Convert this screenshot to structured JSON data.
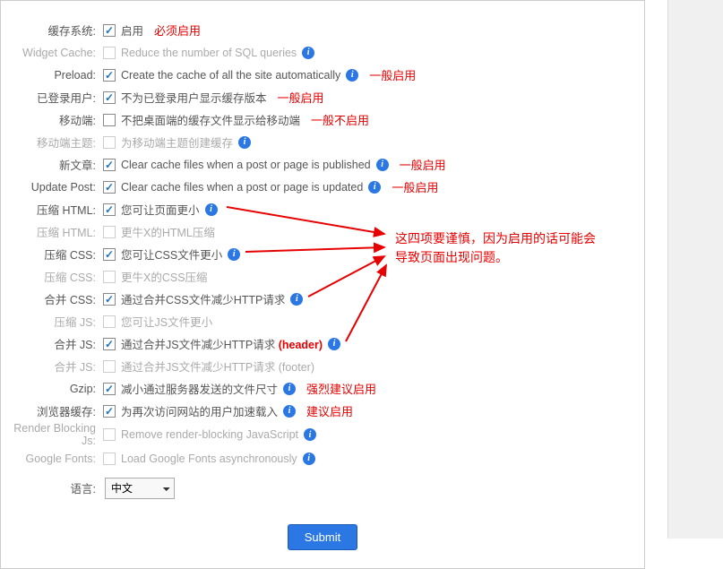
{
  "rows": {
    "cache": {
      "label": "缓存系统:",
      "desc": "启用",
      "checked": true,
      "disabled": false,
      "info": false,
      "note": "必须启用"
    },
    "widget": {
      "label": "Widget Cache:",
      "desc": "Reduce the number of SQL queries",
      "checked": false,
      "disabled": true,
      "info": true
    },
    "preload": {
      "label": "Preload:",
      "desc": "Create the cache of all the site automatically",
      "checked": true,
      "disabled": false,
      "info": true,
      "note": "一般启用"
    },
    "loggedin": {
      "label": "已登录用户:",
      "desc": "不为已登录用户显示缓存版本",
      "checked": true,
      "disabled": false,
      "info": false,
      "note": "一般启用"
    },
    "mobile": {
      "label": "移动端:",
      "desc": "不把桌面端的缓存文件显示给移动端",
      "checked": false,
      "disabled": false,
      "info": false,
      "note": "一般不启用"
    },
    "mobiletheme": {
      "label": "移动端主题:",
      "desc": "为移动端主题创建缓存",
      "checked": false,
      "disabled": true,
      "info": true
    },
    "newpost": {
      "label": "新文章:",
      "desc": "Clear cache files when a post or page is published",
      "checked": true,
      "disabled": false,
      "info": true,
      "note": "一般启用"
    },
    "updatepost": {
      "label": "Update Post:",
      "desc": "Clear cache files when a post or page is updated",
      "checked": true,
      "disabled": false,
      "info": true,
      "note": "一般启用"
    },
    "minhtml": {
      "label": "压缩 HTML:",
      "desc": "您可让页面更小",
      "checked": true,
      "disabled": false,
      "info": true
    },
    "minhtml2": {
      "label": "压缩 HTML:",
      "desc": "更牛X的HTML压缩",
      "checked": false,
      "disabled": true,
      "info": false
    },
    "mincss": {
      "label": "压缩 CSS:",
      "desc": "您可让CSS文件更小",
      "checked": true,
      "disabled": false,
      "info": true
    },
    "mincss2": {
      "label": "压缩 CSS:",
      "desc": "更牛X的CSS压缩",
      "checked": false,
      "disabled": true,
      "info": false
    },
    "combinecss": {
      "label": "合并 CSS:",
      "desc": "通过合并CSS文件减少HTTP请求",
      "checked": true,
      "disabled": false,
      "info": true
    },
    "minjs": {
      "label": "压缩 JS:",
      "desc": "您可让JS文件更小",
      "checked": false,
      "disabled": true,
      "info": false
    },
    "combinejsh": {
      "label": "合并 JS:",
      "desc": "通过合并JS文件减少HTTP请求",
      "header": "(header)",
      "checked": true,
      "disabled": false,
      "info": true
    },
    "combinejsf": {
      "label": "合并 JS:",
      "desc": "通过合并JS文件减少HTTP请求",
      "header": "(footer)",
      "checked": false,
      "disabled": true,
      "info": false
    },
    "gzip": {
      "label": "Gzip:",
      "desc": "减小通过服务器发送的文件尺寸",
      "checked": true,
      "disabled": false,
      "info": true,
      "note": "强烈建议启用"
    },
    "browser": {
      "label": "浏览器缓存:",
      "desc": "为再次访问网站的用户加速载入",
      "checked": true,
      "disabled": false,
      "info": true,
      "note": "建议启用"
    },
    "renderblock": {
      "label": "Render Blocking Js:",
      "desc": "Remove render-blocking JavaScript",
      "checked": false,
      "disabled": true,
      "info": true
    },
    "googlefonts": {
      "label": "Google Fonts:",
      "desc": "Load Google Fonts asynchronously",
      "checked": false,
      "disabled": true,
      "info": true
    }
  },
  "language": {
    "label": "语言:",
    "value": "中文"
  },
  "submit": "Submit",
  "float_note": "这四项要谨慎，因为启用的话可能会\n导致页面出现问题。"
}
